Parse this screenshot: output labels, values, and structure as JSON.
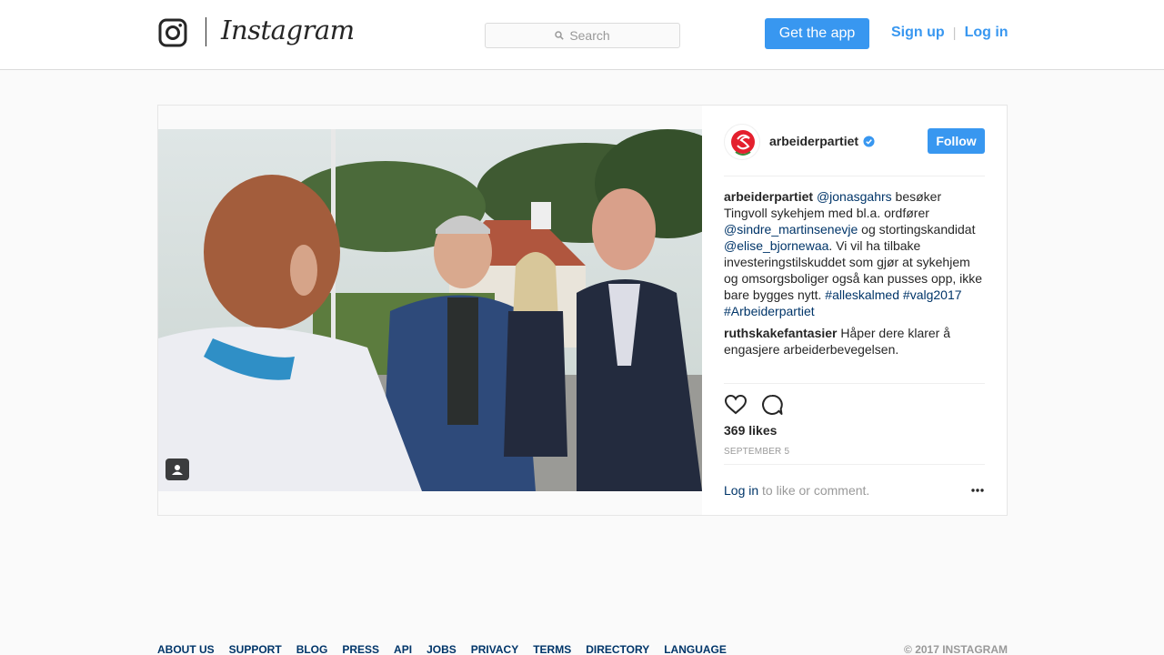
{
  "header": {
    "wordmark": "Instagram",
    "search_placeholder": "Search",
    "get_app_label": "Get the app",
    "signup_label": "Sign up",
    "separator": "|",
    "login_label": "Log in",
    "icons": {
      "logo": "instagram-camera-icon",
      "search": "search-icon"
    }
  },
  "post": {
    "username": "arbeiderpartiet",
    "follow_label": "Follow",
    "caption": {
      "author": "arbeiderpartiet",
      "mention1": "@jonasgahrs",
      "text1": " besøker Tingvoll sykehjem med bl.a. ordfører ",
      "mention2": "@sindre_martinsenevje",
      "text2": " og stortingskandidat ",
      "mention3": "@elise_bjornewaa",
      "text3": ". Vi vil ha tilbake investeringstilskuddet som gjør at sykehjem og omsorgsboliger også kan pusses opp, ikke bare bygges nytt. ",
      "hashtag1": "#alleskalmed",
      "hashtag2": "#valg2017",
      "hashtag3": "#Arbeiderpartiet"
    },
    "comment": {
      "author": "ruthskakefantasier",
      "text": " Håper dere klarer å engasjere arbeiderbevegelsen."
    },
    "likes": "369 likes",
    "date": "SEPTEMBER 5",
    "login_prompt_link": "Log in",
    "login_prompt_text": " to like or comment.",
    "icons": {
      "verified": "verified-badge-icon",
      "like": "heart-icon",
      "comment": "comment-bubble-icon",
      "more": "more-options-icon",
      "tag": "tagged-people-icon"
    },
    "colors": {
      "accent": "#3897f0",
      "link": "#003569",
      "avatar_rose": "#e4202e"
    }
  },
  "footer": {
    "links": [
      "ABOUT US",
      "SUPPORT",
      "BLOG",
      "PRESS",
      "API",
      "JOBS",
      "PRIVACY",
      "TERMS",
      "DIRECTORY",
      "LANGUAGE"
    ],
    "copyright": "© 2017 INSTAGRAM"
  }
}
